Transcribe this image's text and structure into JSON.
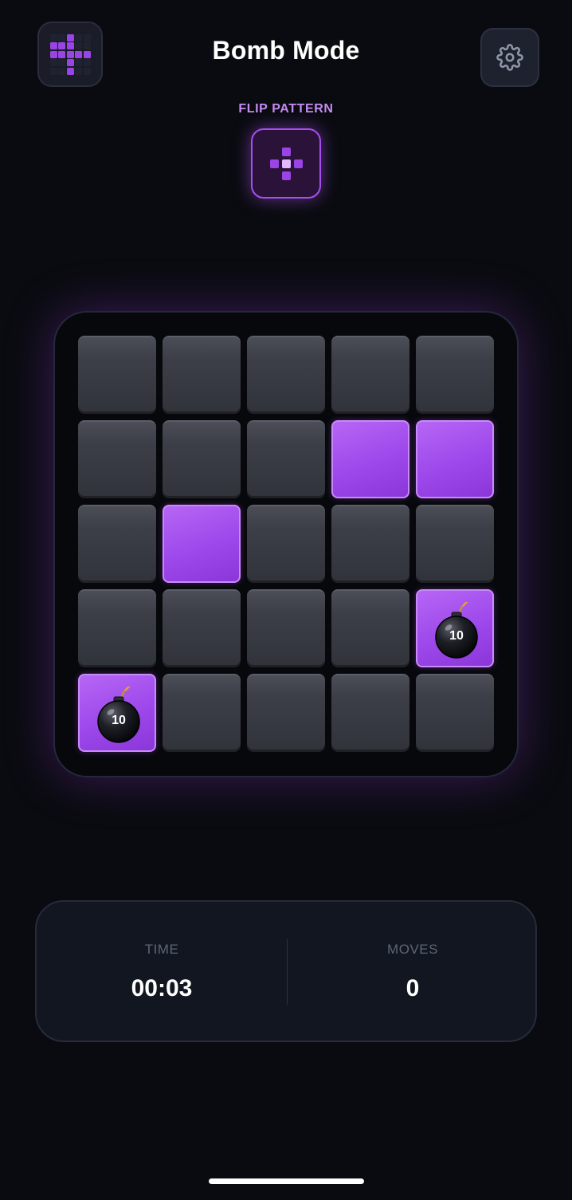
{
  "header": {
    "title": "Bomb Mode",
    "logo_icon": "grid-logo-icon",
    "settings_icon": "gear-icon"
  },
  "pattern": {
    "label": "FLIP PATTERN",
    "cells": [
      0,
      1,
      0,
      1,
      2,
      1,
      0,
      1,
      0
    ]
  },
  "logo": {
    "cells": [
      0,
      0,
      1,
      0,
      0,
      1,
      1,
      1,
      0,
      0,
      1,
      1,
      1,
      1,
      1,
      0,
      0,
      1,
      0,
      0,
      0,
      0,
      1,
      0,
      0
    ]
  },
  "board": {
    "rows": 5,
    "cols": 5,
    "cells": [
      [
        {
          "on": false
        },
        {
          "on": false
        },
        {
          "on": false
        },
        {
          "on": false
        },
        {
          "on": false
        }
      ],
      [
        {
          "on": false
        },
        {
          "on": false
        },
        {
          "on": false
        },
        {
          "on": true
        },
        {
          "on": true
        }
      ],
      [
        {
          "on": false
        },
        {
          "on": true
        },
        {
          "on": false
        },
        {
          "on": false
        },
        {
          "on": false
        }
      ],
      [
        {
          "on": false
        },
        {
          "on": false
        },
        {
          "on": false
        },
        {
          "on": false
        },
        {
          "on": true,
          "bomb": "10"
        }
      ],
      [
        {
          "on": true,
          "bomb": "10"
        },
        {
          "on": false
        },
        {
          "on": false
        },
        {
          "on": false
        },
        {
          "on": false
        }
      ]
    ]
  },
  "stats": {
    "time_label": "TIME",
    "time_value": "00:03",
    "moves_label": "MOVES",
    "moves_value": "0"
  },
  "colors": {
    "accent": "#9d48eb",
    "background": "#0a0b10"
  }
}
